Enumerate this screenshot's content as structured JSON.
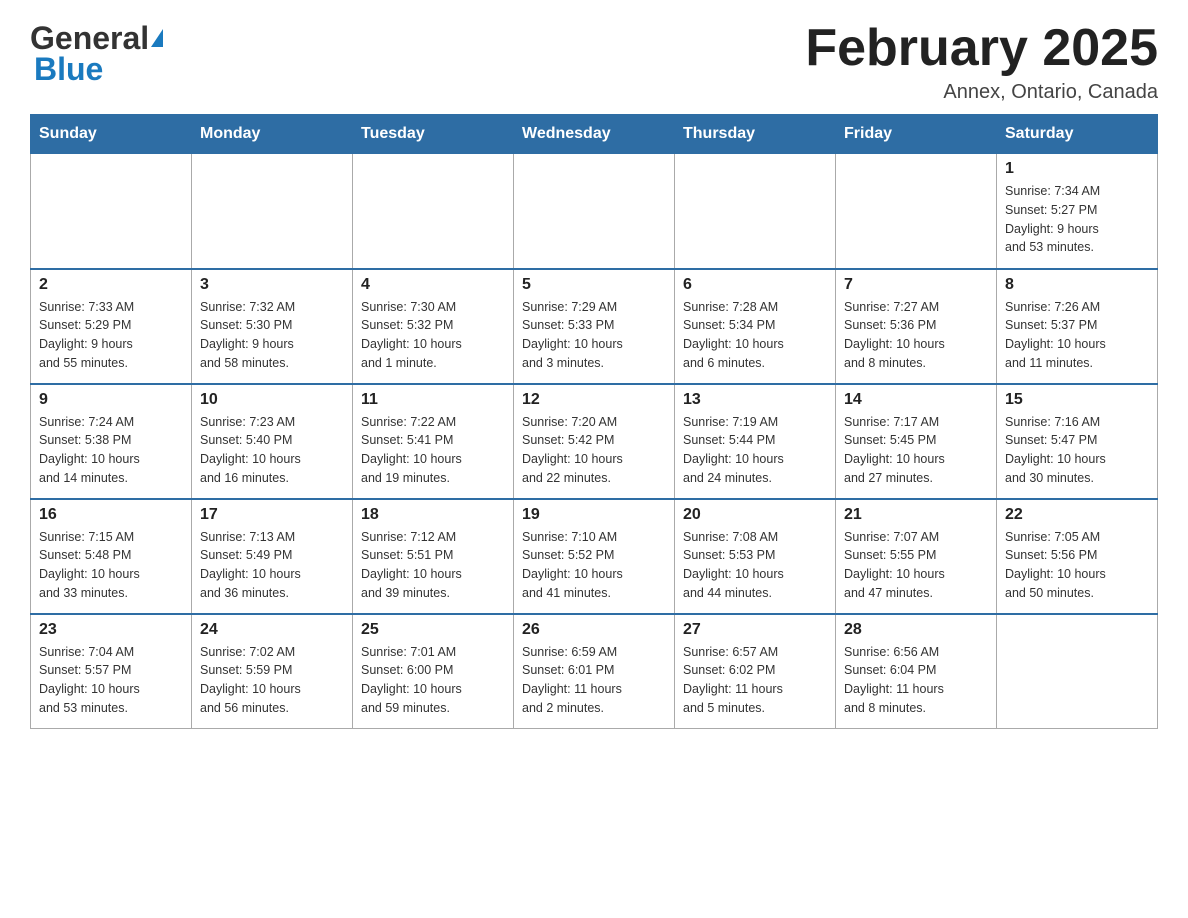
{
  "header": {
    "logo_general": "General",
    "logo_blue": "Blue",
    "month_title": "February 2025",
    "location": "Annex, Ontario, Canada"
  },
  "days_of_week": [
    "Sunday",
    "Monday",
    "Tuesday",
    "Wednesday",
    "Thursday",
    "Friday",
    "Saturday"
  ],
  "weeks": [
    [
      {
        "day": "",
        "info": ""
      },
      {
        "day": "",
        "info": ""
      },
      {
        "day": "",
        "info": ""
      },
      {
        "day": "",
        "info": ""
      },
      {
        "day": "",
        "info": ""
      },
      {
        "day": "",
        "info": ""
      },
      {
        "day": "1",
        "info": "Sunrise: 7:34 AM\nSunset: 5:27 PM\nDaylight: 9 hours\nand 53 minutes."
      }
    ],
    [
      {
        "day": "2",
        "info": "Sunrise: 7:33 AM\nSunset: 5:29 PM\nDaylight: 9 hours\nand 55 minutes."
      },
      {
        "day": "3",
        "info": "Sunrise: 7:32 AM\nSunset: 5:30 PM\nDaylight: 9 hours\nand 58 minutes."
      },
      {
        "day": "4",
        "info": "Sunrise: 7:30 AM\nSunset: 5:32 PM\nDaylight: 10 hours\nand 1 minute."
      },
      {
        "day": "5",
        "info": "Sunrise: 7:29 AM\nSunset: 5:33 PM\nDaylight: 10 hours\nand 3 minutes."
      },
      {
        "day": "6",
        "info": "Sunrise: 7:28 AM\nSunset: 5:34 PM\nDaylight: 10 hours\nand 6 minutes."
      },
      {
        "day": "7",
        "info": "Sunrise: 7:27 AM\nSunset: 5:36 PM\nDaylight: 10 hours\nand 8 minutes."
      },
      {
        "day": "8",
        "info": "Sunrise: 7:26 AM\nSunset: 5:37 PM\nDaylight: 10 hours\nand 11 minutes."
      }
    ],
    [
      {
        "day": "9",
        "info": "Sunrise: 7:24 AM\nSunset: 5:38 PM\nDaylight: 10 hours\nand 14 minutes."
      },
      {
        "day": "10",
        "info": "Sunrise: 7:23 AM\nSunset: 5:40 PM\nDaylight: 10 hours\nand 16 minutes."
      },
      {
        "day": "11",
        "info": "Sunrise: 7:22 AM\nSunset: 5:41 PM\nDaylight: 10 hours\nand 19 minutes."
      },
      {
        "day": "12",
        "info": "Sunrise: 7:20 AM\nSunset: 5:42 PM\nDaylight: 10 hours\nand 22 minutes."
      },
      {
        "day": "13",
        "info": "Sunrise: 7:19 AM\nSunset: 5:44 PM\nDaylight: 10 hours\nand 24 minutes."
      },
      {
        "day": "14",
        "info": "Sunrise: 7:17 AM\nSunset: 5:45 PM\nDaylight: 10 hours\nand 27 minutes."
      },
      {
        "day": "15",
        "info": "Sunrise: 7:16 AM\nSunset: 5:47 PM\nDaylight: 10 hours\nand 30 minutes."
      }
    ],
    [
      {
        "day": "16",
        "info": "Sunrise: 7:15 AM\nSunset: 5:48 PM\nDaylight: 10 hours\nand 33 minutes."
      },
      {
        "day": "17",
        "info": "Sunrise: 7:13 AM\nSunset: 5:49 PM\nDaylight: 10 hours\nand 36 minutes."
      },
      {
        "day": "18",
        "info": "Sunrise: 7:12 AM\nSunset: 5:51 PM\nDaylight: 10 hours\nand 39 minutes."
      },
      {
        "day": "19",
        "info": "Sunrise: 7:10 AM\nSunset: 5:52 PM\nDaylight: 10 hours\nand 41 minutes."
      },
      {
        "day": "20",
        "info": "Sunrise: 7:08 AM\nSunset: 5:53 PM\nDaylight: 10 hours\nand 44 minutes."
      },
      {
        "day": "21",
        "info": "Sunrise: 7:07 AM\nSunset: 5:55 PM\nDaylight: 10 hours\nand 47 minutes."
      },
      {
        "day": "22",
        "info": "Sunrise: 7:05 AM\nSunset: 5:56 PM\nDaylight: 10 hours\nand 50 minutes."
      }
    ],
    [
      {
        "day": "23",
        "info": "Sunrise: 7:04 AM\nSunset: 5:57 PM\nDaylight: 10 hours\nand 53 minutes."
      },
      {
        "day": "24",
        "info": "Sunrise: 7:02 AM\nSunset: 5:59 PM\nDaylight: 10 hours\nand 56 minutes."
      },
      {
        "day": "25",
        "info": "Sunrise: 7:01 AM\nSunset: 6:00 PM\nDaylight: 10 hours\nand 59 minutes."
      },
      {
        "day": "26",
        "info": "Sunrise: 6:59 AM\nSunset: 6:01 PM\nDaylight: 11 hours\nand 2 minutes."
      },
      {
        "day": "27",
        "info": "Sunrise: 6:57 AM\nSunset: 6:02 PM\nDaylight: 11 hours\nand 5 minutes."
      },
      {
        "day": "28",
        "info": "Sunrise: 6:56 AM\nSunset: 6:04 PM\nDaylight: 11 hours\nand 8 minutes."
      },
      {
        "day": "",
        "info": ""
      }
    ]
  ]
}
